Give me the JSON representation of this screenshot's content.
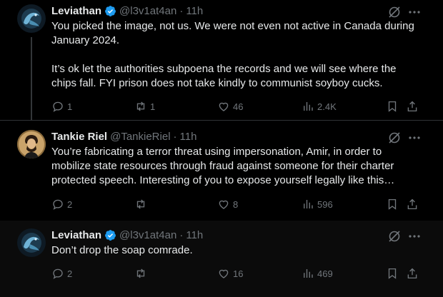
{
  "tweets": [
    {
      "name": "Leviathan",
      "verified": true,
      "handle": "@l3v1at4an",
      "time": "11h",
      "text_lines": [
        "You picked the image, not us. We were not even not active in Canada during",
        "January 2024.",
        "",
        "It’s ok let the authorities subpoena the records and we will see where the",
        "chips fall. FYI prison does not take kindly to communist soyboy cucks."
      ],
      "replies": "1",
      "reposts": "1",
      "likes": "46",
      "views": "2.4K"
    },
    {
      "name": "Tankie Riel",
      "verified": false,
      "handle": "@TankieRiel",
      "time": "11h",
      "text_lines": [
        "You’re fabricating a terror threat using impersonation, Amir, in order to",
        "mobilize state resources through fraud against someone for their charter",
        "protected speech. Interesting of you to expose yourself legally like this…"
      ],
      "replies": "2",
      "reposts": "",
      "likes": "8",
      "views": "596"
    },
    {
      "name": "Leviathan",
      "verified": true,
      "handle": "@l3v1at4an",
      "time": "11h",
      "text_lines": [
        "Don’t drop the soap comrade."
      ],
      "replies": "2",
      "reposts": "",
      "likes": "16",
      "views": "469"
    }
  ],
  "separator": "·",
  "colors": {
    "background": "#000000",
    "text": "#e7e9ea",
    "muted": "#71767b",
    "verified": "#1d9bf0",
    "border": "#2f3336"
  },
  "icons": [
    "reply-icon",
    "repost-icon",
    "like-icon",
    "views-icon",
    "bookmark-icon",
    "share-icon",
    "grok-icon",
    "more-icon",
    "verified-badge-icon"
  ]
}
